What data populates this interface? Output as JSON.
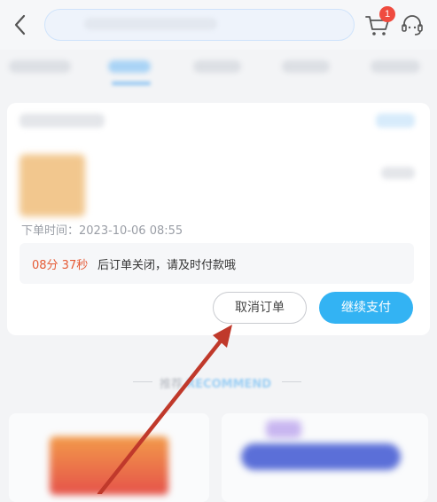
{
  "order": {
    "time_label": "下单时间：",
    "time_value": "2023-10-06 08:55",
    "countdown": "08分 37秒",
    "message": "后订单关闭，请及时付款哦"
  },
  "actions": {
    "cancel_label": "取消订单",
    "pay_label": "继续支付"
  },
  "header": {
    "cart_badge": "1"
  },
  "recommend": {
    "title_cn": "推荐",
    "title_en": "RECOMMEND"
  },
  "colors": {
    "accent": "#33b3f3",
    "countdown": "#e55a35",
    "badge": "#ef4b3f",
    "annotation_arrow": "#c0392b"
  }
}
